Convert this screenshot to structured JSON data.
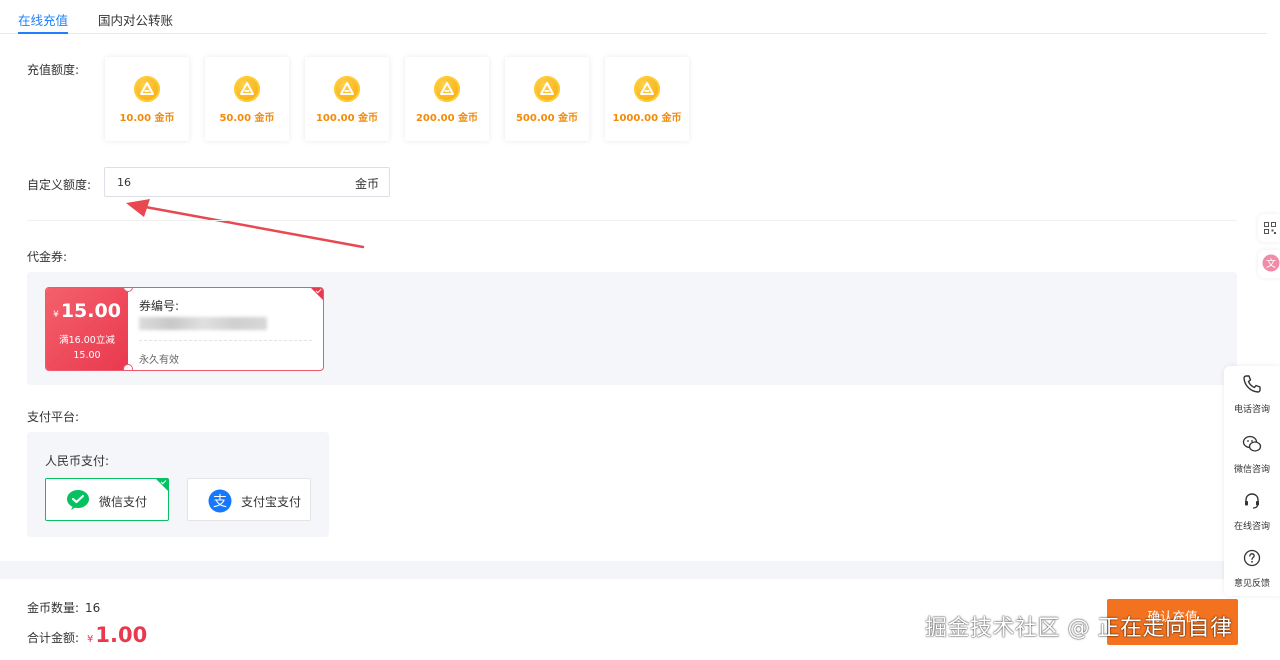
{
  "tabs": [
    {
      "label": "在线充值",
      "active": true
    },
    {
      "label": "国内对公转账",
      "active": false
    }
  ],
  "recharge": {
    "label": "充值额度:",
    "options": [
      "10.00 金币",
      "50.00 金币",
      "100.00 金币",
      "200.00 金币",
      "500.00 金币",
      "1000.00 金币"
    ]
  },
  "custom": {
    "label": "自定义额度:",
    "value": "16",
    "unit": "金币"
  },
  "voucher": {
    "section_label": "代金券:",
    "currency_symbol": "¥",
    "amount": "15.00",
    "condition_line1": "满16.00立减",
    "condition_line2": "15.00",
    "code_label": "券编号:",
    "validity": "永久有效",
    "selected": true
  },
  "payment": {
    "section_label": "支付平台:",
    "group_label": "人民币支付:",
    "methods": [
      {
        "label": "微信支付",
        "icon": "wechat-icon",
        "selected": true
      },
      {
        "label": "支付宝支付",
        "icon": "alipay-icon",
        "selected": false
      }
    ]
  },
  "footer": {
    "count_label": "金币数量:",
    "count_value": "16",
    "total_label": "合计金额:",
    "total_symbol": "¥",
    "total_value": "1.00",
    "confirm_label": "确认充值"
  },
  "sidebar": {
    "items": [
      {
        "label": "电话咨询",
        "icon": "phone-icon"
      },
      {
        "label": "微信咨询",
        "icon": "wechat-chat-icon"
      },
      {
        "label": "在线咨询",
        "icon": "headset-icon"
      },
      {
        "label": "意见反馈",
        "icon": "question-icon"
      }
    ]
  },
  "watermark": "掘金技术社区 @ 正在走向自律",
  "colors": {
    "accent": "#1e80ff",
    "coin_text": "#f28a0a",
    "voucher_red": "#e9394e",
    "wechat_green": "#07c160",
    "alipay_blue": "#1677ff",
    "confirm_orange": "#f3721f"
  }
}
